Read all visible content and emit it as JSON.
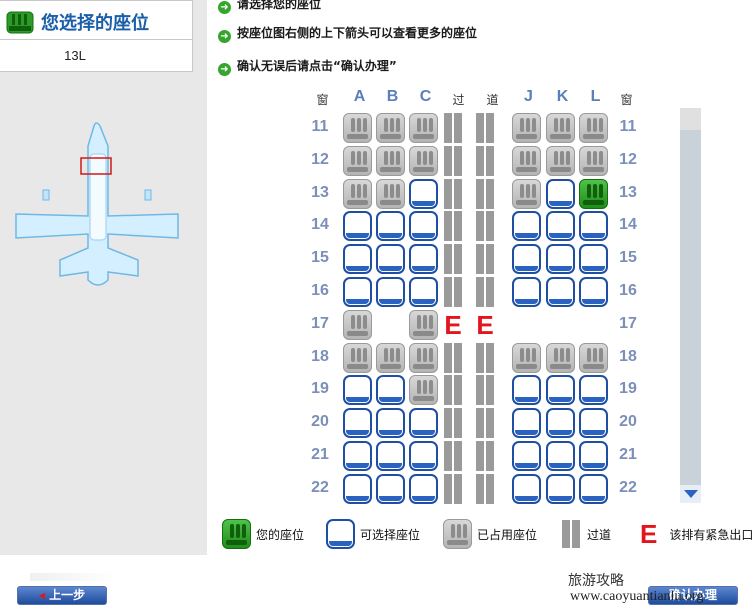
{
  "selection": {
    "title": "您选择的座位",
    "value": "13L"
  },
  "instructions": [
    "请选择您的座位",
    "按座位图右侧的上下箭头可以查看更多的座位",
    "确认无误后请点击“确认办理”"
  ],
  "instruction_icon": "arrow-right-icon",
  "seatmap": {
    "window_label": "窗",
    "aisle_label_1": "过",
    "aisle_label_2": "道",
    "exit_mark": "E",
    "columns_left": [
      "A",
      "B",
      "C"
    ],
    "columns_right": [
      "J",
      "K",
      "L"
    ],
    "rows": [
      {
        "num": "11",
        "left": [
          "occ",
          "occ",
          "occ"
        ],
        "aisle": "bar",
        "right": [
          "occ",
          "occ",
          "occ"
        ]
      },
      {
        "num": "12",
        "left": [
          "occ",
          "occ",
          "occ"
        ],
        "aisle": "bar",
        "right": [
          "occ",
          "occ",
          "occ"
        ]
      },
      {
        "num": "13",
        "left": [
          "occ",
          "occ",
          "avail"
        ],
        "aisle": "bar",
        "right": [
          "occ",
          "avail",
          "mine"
        ]
      },
      {
        "num": "14",
        "left": [
          "avail",
          "avail",
          "avail"
        ],
        "aisle": "bar",
        "right": [
          "avail",
          "avail",
          "avail"
        ]
      },
      {
        "num": "15",
        "left": [
          "avail",
          "avail",
          "avail"
        ],
        "aisle": "bar",
        "right": [
          "avail",
          "avail",
          "avail"
        ]
      },
      {
        "num": "16",
        "left": [
          "avail",
          "avail",
          "avail"
        ],
        "aisle": "bar",
        "right": [
          "avail",
          "avail",
          "avail"
        ]
      },
      {
        "num": "17",
        "left": [
          "occ",
          "none",
          "occ"
        ],
        "aisle": "exit",
        "right": [
          "none",
          "none",
          "none"
        ]
      },
      {
        "num": "18",
        "left": [
          "occ",
          "occ",
          "occ"
        ],
        "aisle": "bar",
        "right": [
          "occ",
          "occ",
          "occ"
        ]
      },
      {
        "num": "19",
        "left": [
          "avail",
          "avail",
          "occ"
        ],
        "aisle": "bar",
        "right": [
          "avail",
          "avail",
          "avail"
        ]
      },
      {
        "num": "20",
        "left": [
          "avail",
          "avail",
          "avail"
        ],
        "aisle": "bar",
        "right": [
          "avail",
          "avail",
          "avail"
        ]
      },
      {
        "num": "21",
        "left": [
          "avail",
          "avail",
          "avail"
        ],
        "aisle": "bar",
        "right": [
          "avail",
          "avail",
          "avail"
        ]
      },
      {
        "num": "22",
        "left": [
          "avail",
          "avail",
          "avail"
        ],
        "aisle": "bar",
        "right": [
          "avail",
          "avail",
          "avail"
        ]
      }
    ]
  },
  "legend": {
    "mine": "您的座位",
    "available": "可选择座位",
    "occupied": "已占用座位",
    "aisle": "过道",
    "exit": "该排有紧急出口",
    "exit_mark": "E"
  },
  "buttons": {
    "prev": "上一步",
    "next": "确认办理"
  },
  "watermark": {
    "line1": "旅游攻略",
    "line2": "www.caoyuantianlu.org"
  },
  "colors": {
    "available_seat": "#1e4fa3",
    "occupied_seat": "#b4b4b4",
    "my_seat": "#1f8d1a",
    "exit": "#e3141b",
    "button": "#1e4c9c"
  }
}
